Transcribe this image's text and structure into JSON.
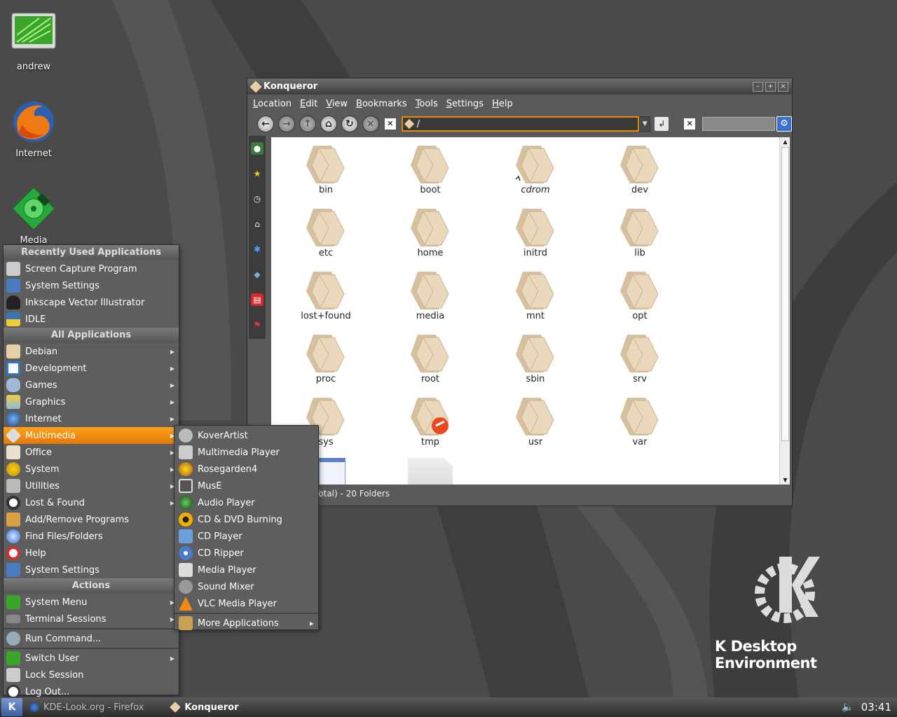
{
  "desktop": {
    "icons": [
      {
        "label": "andrew"
      },
      {
        "label": "Internet"
      },
      {
        "label": "Media"
      }
    ],
    "logo_text": "K Desktop Environment"
  },
  "konqueror": {
    "title": "Konqueror",
    "menu": [
      "Location",
      "Edit",
      "View",
      "Bookmarks",
      "Tools",
      "Settings",
      "Help"
    ],
    "location_value": "/",
    "folders": [
      "bin",
      "boot",
      "cdrom",
      "dev",
      "etc",
      "home",
      "initrd",
      "lib",
      "lost+found",
      "media",
      "mnt",
      "opt",
      "proc",
      "root",
      "sbin",
      "srv",
      "sys",
      "tmp",
      "usr",
      "var"
    ],
    "status": "s - 2 Files (0 B Total) - 20 Folders"
  },
  "kmenu": {
    "recent_header": "Recently Used Applications",
    "recent": [
      "Screen Capture Program",
      "System Settings",
      "Inkscape Vector Illustrator",
      "IDLE"
    ],
    "all_header": "All Applications",
    "all": [
      "Debian",
      "Development",
      "Games",
      "Graphics",
      "Internet",
      "Multimedia",
      "Office",
      "System",
      "Utilities",
      "Lost & Found",
      "Add/Remove Programs",
      "Find Files/Folders",
      "Help",
      "System Settings"
    ],
    "actions_header": "Actions",
    "actions": [
      "System Menu",
      "Terminal Sessions",
      "Run Command...",
      "Switch User",
      "Lock Session",
      "Log Out..."
    ]
  },
  "submenu": {
    "items": [
      "KoverArtist",
      "Multimedia Player",
      "Rosegarden4",
      "MusE",
      "Audio Player",
      "CD & DVD Burning",
      "CD Player",
      "CD Ripper",
      "Media Player",
      "Sound Mixer",
      "VLC Media Player"
    ],
    "more": "More Applications"
  },
  "taskbar": {
    "tasks": [
      "KDE-Look.org - Firefox",
      "Konqueror"
    ],
    "clock": "03:41"
  },
  "colors": {
    "accent": "#f08a10",
    "folder": "#ead8bd",
    "panel": "#5e5e5e"
  }
}
